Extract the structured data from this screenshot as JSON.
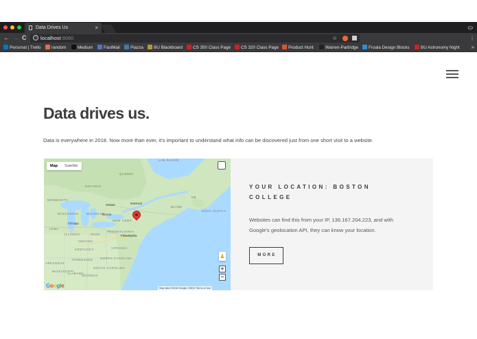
{
  "browser": {
    "tab_title": "Data Drives Us",
    "tab_close": "×",
    "back": "←",
    "forward": "→",
    "reload": "C",
    "url_host": "localhost",
    "url_port": ":8080",
    "star": "☆",
    "bookmarks": [
      {
        "label": "Personal | Trello",
        "color": "#0079bf"
      },
      {
        "label": "random",
        "color": "#e8703a"
      },
      {
        "label": "Medium",
        "color": "#111111"
      },
      {
        "label": "FastMail",
        "color": "#4a78c2"
      },
      {
        "label": "Piazza",
        "color": "#3e7cb1"
      },
      {
        "label": "BU Blackboard",
        "color": "#b09a3a"
      },
      {
        "label": "CS 350 Class Page",
        "color": "#cc2222"
      },
      {
        "label": "CS 320 Class Page",
        "color": "#cc2222"
      },
      {
        "label": "Product Hunt",
        "color": "#da552f"
      },
      {
        "label": "Warren-Partridge",
        "color": "#222222"
      },
      {
        "label": "Froala Design Blocks",
        "color": "#2e8fd6"
      },
      {
        "label": "BU Astronomy Night",
        "color": "#cc2222"
      }
    ],
    "bookmarks_more": "»"
  },
  "page": {
    "title": "Data drives us.",
    "intro": "Data is everywhere in 2018. Now more than ever, it's important to understand what info can be discovered just from one short visit to a website."
  },
  "map": {
    "type_map": "Map",
    "type_satellite": "Satellite",
    "zoom_in": "+",
    "zoom_out": "−",
    "google_logo": [
      "G",
      "o",
      "o",
      "g",
      "l",
      "e"
    ],
    "google_colors": [
      "#4285f4",
      "#ea4335",
      "#fbbc05",
      "#4285f4",
      "#34a853",
      "#ea4335"
    ],
    "attribution": "Map data ©2018 Google, INEGI   Terms of Use",
    "labels": {
      "labrador": "LAB RADOR",
      "quebec": "QUEBEC",
      "ontario": "ONTARIO",
      "nb": "NB",
      "maine": "MAINE",
      "novascotia": "NOVA SCOTIA",
      "minnesota": "MINNESOTA",
      "wisconsin": "WISCONSIN",
      "michigan": "MICHIGAN",
      "newyork": "NEW YORK",
      "iowa": "IOWA",
      "ohio": "OHIO",
      "pa": "PENNSYLVANIA",
      "illinois": "ILLINOIS",
      "indiana": "INDIANA",
      "kentucky": "KENTUCKY",
      "virginia": "VIRGINIA",
      "northcarolina": "NORTH CAROLINA",
      "tennessee": "TENNESSEE",
      "southcarolina": "SOUTH CAROLINA",
      "arkansas": "ARKANSAS",
      "mississippi": "MISSISSIPPI",
      "alabama": "ALABAMA",
      "georgia": "GEORGIA",
      "ottawa": "Ottawa",
      "montreal": "Montreal",
      "toronto": "Toronto",
      "chicago": "Chicago",
      "philadelphia": "Philadelphia"
    }
  },
  "panel": {
    "title": "YOUR LOCATION: BOSTON COLLEGE",
    "text": "Websites can find this from your IP, 136.167.204.223, and with Google's geolocation API, they can know your location.",
    "button": "MORE"
  }
}
